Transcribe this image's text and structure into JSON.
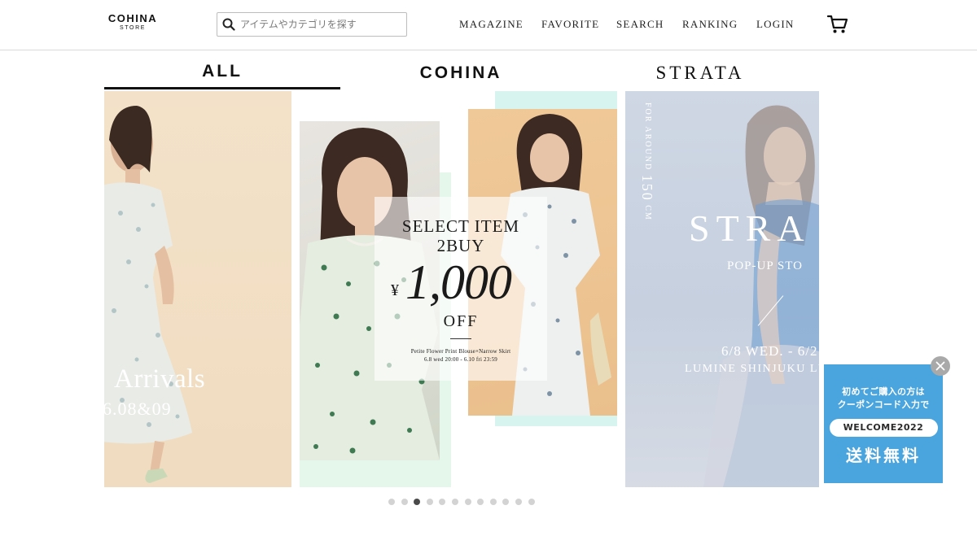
{
  "header": {
    "logo": {
      "main": "COHINA",
      "sub": "STORE"
    },
    "search": {
      "placeholder": "アイテムやカテゴリを探す",
      "icon": "search-icon"
    },
    "nav": [
      {
        "label": "MAGAZINE"
      },
      {
        "label": "FAVORITE"
      },
      {
        "label": "SEARCH"
      },
      {
        "label": "RANKING"
      },
      {
        "label": "LOGIN"
      }
    ],
    "cart_icon": "cart-icon"
  },
  "tabs": [
    {
      "label": "ALL",
      "active": true
    },
    {
      "label": "COHINA",
      "active": false
    },
    {
      "label": "STRATA",
      "active": false
    }
  ],
  "carousel": {
    "slide_1": {
      "title": "Arrivals",
      "date": "6.08&09"
    },
    "slide_2": {
      "line1": "SELECT ITEM",
      "line2": "2BUY",
      "currency": "¥",
      "price": "1,000",
      "off": "OFF",
      "items": "Petite Flower Print Blouse×Narrow Skirt",
      "period": "6.8 wed 20:00 - 6.10 fri 23:59"
    },
    "slide_3": {
      "vertical_prefix": "FOR AROUND",
      "vertical_number": "150",
      "vertical_unit": "CM",
      "brand": "STRA",
      "subtitle": "POP-UP STO",
      "dates": "6/8 WED.  -  6/2",
      "venue": "LUMINE SHINJUKU LU"
    },
    "dot_count": 12,
    "active_dot": 3
  },
  "coupon": {
    "line1": "初めてご購入の方は",
    "line2": "クーポンコード入力で",
    "code": "WELCOME2022",
    "benefit": "送料無料",
    "close_icon": "close-icon"
  },
  "colors": {
    "coupon_bg": "#4aa4dd",
    "active_tab_underline": "#111111",
    "dot_active": "#4a4a4a",
    "dot_inactive": "#d3d3d3"
  }
}
